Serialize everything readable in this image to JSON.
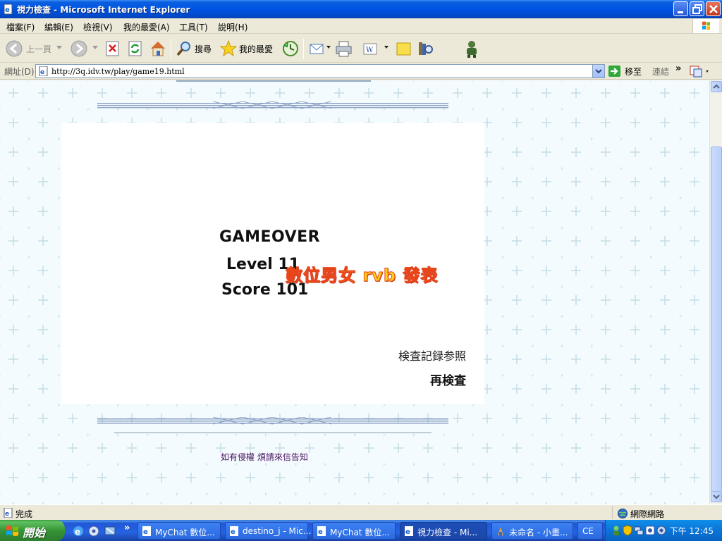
{
  "window": {
    "title": "視力檢查 - Microsoft Internet Explorer"
  },
  "menu": [
    "檔案(F)",
    "編輯(E)",
    "檢視(V)",
    "我的最愛(A)",
    "工具(T)",
    "說明(H)"
  ],
  "toolbar": {
    "back_label": "上一頁",
    "search_label": "搜尋",
    "favorites_label": "我的最愛"
  },
  "address": {
    "label": "網址(D)",
    "url": "http://3q.idv.tw/play/game19.html",
    "go_label": "移至",
    "links_label": "連結",
    "more": "»"
  },
  "game": {
    "gameover": "GAMEOVER",
    "level_text": "Level 11",
    "score_text": "Score 101",
    "watermark": "數位男女 rvb 發表",
    "record_link": "検査記録参照",
    "retry_link": "再検査"
  },
  "footer": {
    "notice": "如有侵權 煩請來信告知"
  },
  "status": {
    "text": "完成",
    "zone": "網際網路"
  },
  "taskbar": {
    "start_label": "開始",
    "tasks": [
      {
        "label": "MyChat 數位...",
        "active": false
      },
      {
        "label": "destino_j - Mic...",
        "active": false
      },
      {
        "label": "MyChat 數位...",
        "active": false
      },
      {
        "label": "視力檢查 - Mi...",
        "active": true
      },
      {
        "label": "未命名 - 小畫...",
        "active": false
      },
      {
        "label": "CE",
        "active": false
      }
    ],
    "quicklaunch_more": "»",
    "clock": "下午 12:45"
  },
  "colors": {
    "title_blue": "#0054e3",
    "page_bg": "#f3fbfe",
    "watermark_yellow": "#ffd21a",
    "watermark_red": "#e8451a",
    "notice_purple": "#4a1060"
  }
}
